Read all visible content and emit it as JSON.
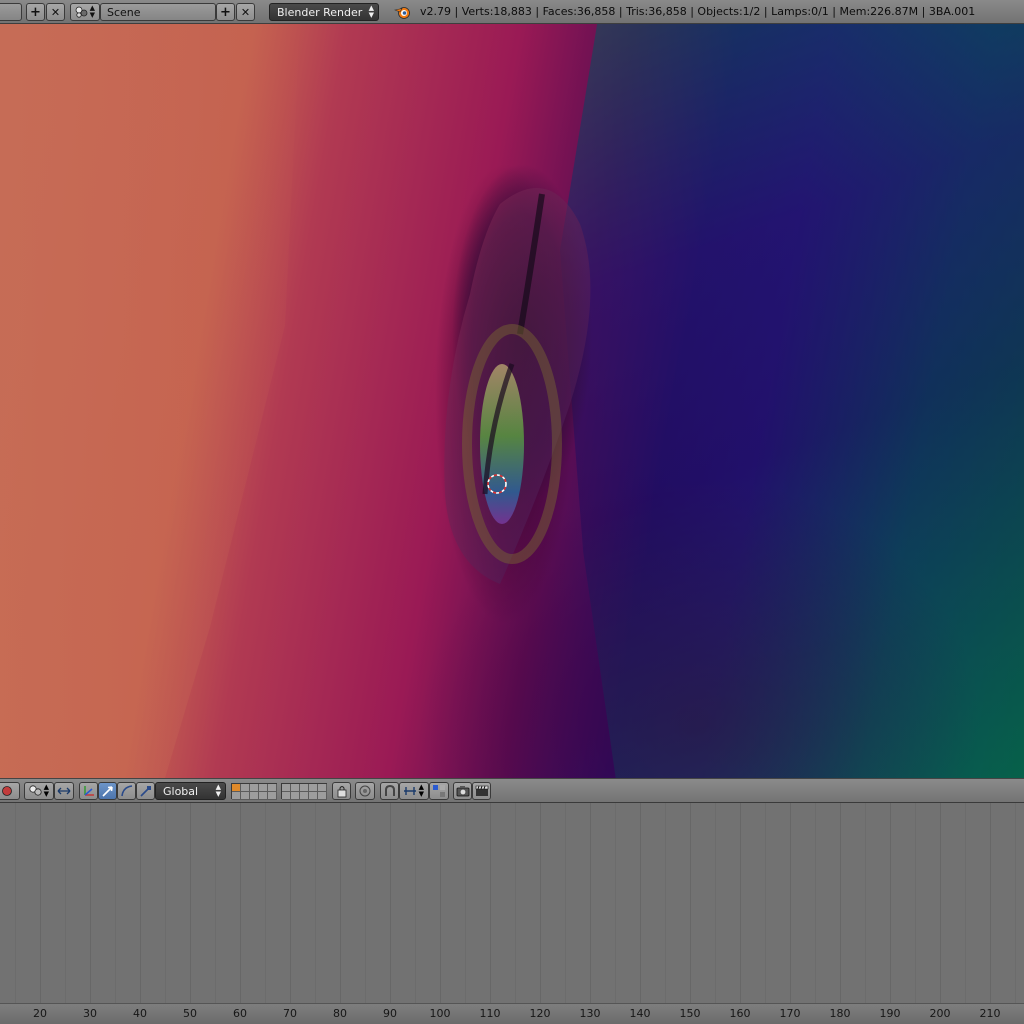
{
  "header": {
    "scene_name": "Scene",
    "render_engine": "Blender Render",
    "stats": "v2.79 | Verts:18,883 | Faces:36,858 | Tris:36,858 | Objects:1/2 | Lamps:0/1 | Mem:226.87M | 3BA.001",
    "add_symbol": "+",
    "close_symbol": "✕"
  },
  "toolbar": {
    "transform_orientation": "Global"
  },
  "timeline": {
    "frame_ticks": [
      "20",
      "30",
      "40",
      "50",
      "60",
      "70",
      "80",
      "90",
      "100",
      "110",
      "120",
      "130",
      "140",
      "150",
      "160",
      "170",
      "180",
      "190",
      "200",
      "210"
    ]
  },
  "colors": {
    "header_bg": "#7d7d7d",
    "timeline_bg": "#727272",
    "active_button": "#5a82ba",
    "render_select": "#3a3a3a"
  },
  "icons": [
    "add-icon",
    "close-icon",
    "scene-icon",
    "blender-logo-icon",
    "viewport-shading-icon",
    "pivot-icon",
    "manipulator-icon",
    "translate-icon",
    "rotate-icon",
    "scale-icon",
    "layer-lock-icon",
    "proportional-edit-icon",
    "snap-icon",
    "snap-element-icon",
    "render-icon",
    "clapper-icon"
  ]
}
